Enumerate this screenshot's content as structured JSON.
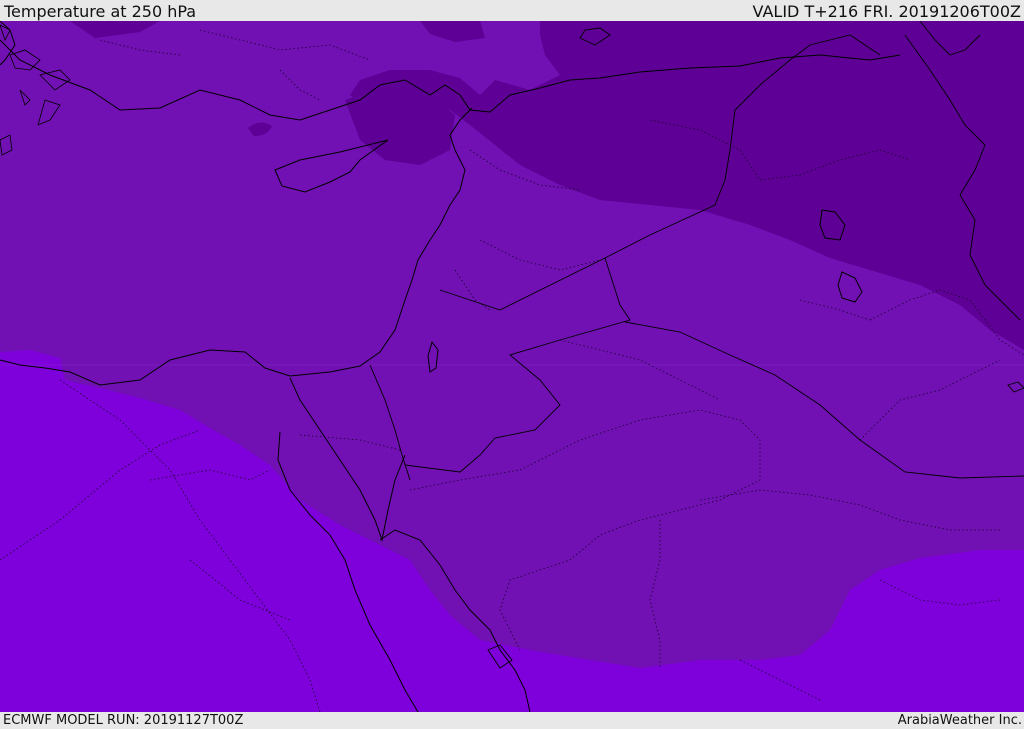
{
  "header": {
    "title": "Temperature at 250 hPa",
    "valid": "VALID T+216 FRI. 20191206T00Z"
  },
  "footer": {
    "model_run": "ECMWF MODEL RUN: 20191127T00Z",
    "credit": "ArabiaWeather Inc."
  },
  "colors": {
    "band_cold": "#5e0095",
    "band_mid": "#7111b3",
    "band_warm": "#7e00da",
    "band_warmer": "#8608e6",
    "coast": "#000000",
    "bar_bg": "#e8e8e8"
  }
}
